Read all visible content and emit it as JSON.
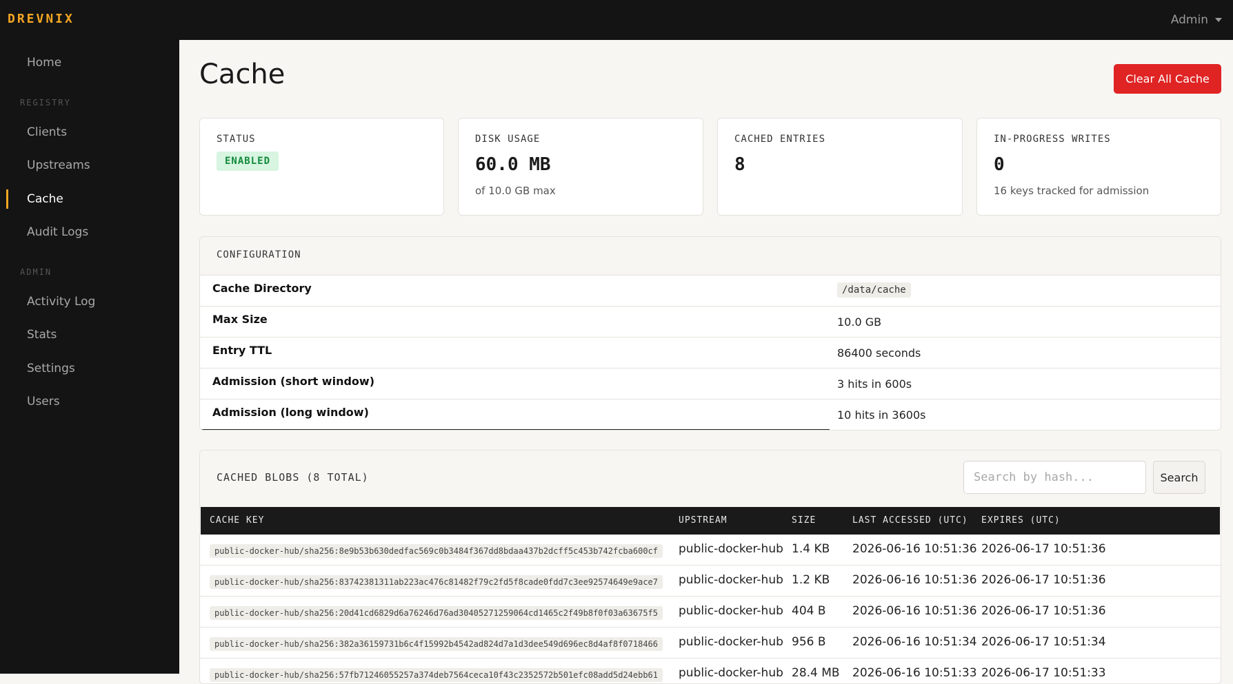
{
  "header": {
    "brand": "DREVNIX",
    "user": "Admin"
  },
  "sidebar": {
    "items": [
      {
        "label": "Home"
      },
      {
        "section": "REGISTRY"
      },
      {
        "label": "Clients"
      },
      {
        "label": "Upstreams"
      },
      {
        "label": "Cache",
        "active": true
      },
      {
        "label": "Audit Logs"
      },
      {
        "section": "ADMIN"
      },
      {
        "label": "Activity Log"
      },
      {
        "label": "Stats"
      },
      {
        "label": "Settings"
      },
      {
        "label": "Users"
      }
    ]
  },
  "page": {
    "title": "Cache",
    "clear_button": "Clear All Cache"
  },
  "cards": {
    "status": {
      "label": "STATUS",
      "badge": "ENABLED"
    },
    "disk": {
      "label": "DISK USAGE",
      "value": "60.0 MB",
      "sub": "of 10.0 GB max"
    },
    "entries": {
      "label": "CACHED ENTRIES",
      "value": "8"
    },
    "writes": {
      "label": "IN-PROGRESS WRITES",
      "value": "0",
      "sub": "16 keys tracked for admission"
    }
  },
  "config": {
    "title": "CONFIGURATION",
    "rows": [
      {
        "key": "Cache Directory",
        "value": "/data/cache"
      },
      {
        "key": "Max Size",
        "value": "10.0 GB"
      },
      {
        "key": "Entry TTL",
        "value": "86400 seconds"
      },
      {
        "key": "Admission (short window)",
        "value": "3 hits in 600s"
      },
      {
        "key": "Admission (long window)",
        "value": "10 hits in 3600s"
      }
    ]
  },
  "blobs": {
    "title": "CACHED BLOBS (8 TOTAL)",
    "search_placeholder": "Search by hash...",
    "search_button": "Search",
    "columns": [
      "CACHE KEY",
      "UPSTREAM",
      "SIZE",
      "LAST ACCESSED (UTC)",
      "EXPIRES (UTC)"
    ],
    "rows": [
      {
        "key": "public-docker-hub/sha256:8e9b53b630dedfac569c0b3484f367dd8bdaa437b2dcff5c453b742fcba600cf",
        "upstream": "public-docker-hub",
        "size": "1.4 KB",
        "accessed": "2026-06-16 10:51:36",
        "expires": "2026-06-17 10:51:36"
      },
      {
        "key": "public-docker-hub/sha256:83742381311ab223ac476c81482f79c2fd5f8cade0fdd7c3ee92574649e9ace7",
        "upstream": "public-docker-hub",
        "size": "1.2 KB",
        "accessed": "2026-06-16 10:51:36",
        "expires": "2026-06-17 10:51:36"
      },
      {
        "key": "public-docker-hub/sha256:20d41cd6829d6a76246d76ad30405271259064cd1465c2f49b8f0f03a63675f5",
        "upstream": "public-docker-hub",
        "size": "404 B",
        "accessed": "2026-06-16 10:51:36",
        "expires": "2026-06-17 10:51:36"
      },
      {
        "key": "public-docker-hub/sha256:382a36159731b6c4f15992b4542ad824d7a1d3dee549d696ec8d4af8f0718466",
        "upstream": "public-docker-hub",
        "size": "956 B",
        "accessed": "2026-06-16 10:51:34",
        "expires": "2026-06-17 10:51:34"
      },
      {
        "key": "public-docker-hub/sha256:57fb71246055257a374deb7564ceca10f43c2352572b501efc08add5d24ebb61",
        "upstream": "public-docker-hub",
        "size": "28.4 MB",
        "accessed": "2026-06-16 10:51:33",
        "expires": "2026-06-17 10:51:33"
      }
    ]
  }
}
